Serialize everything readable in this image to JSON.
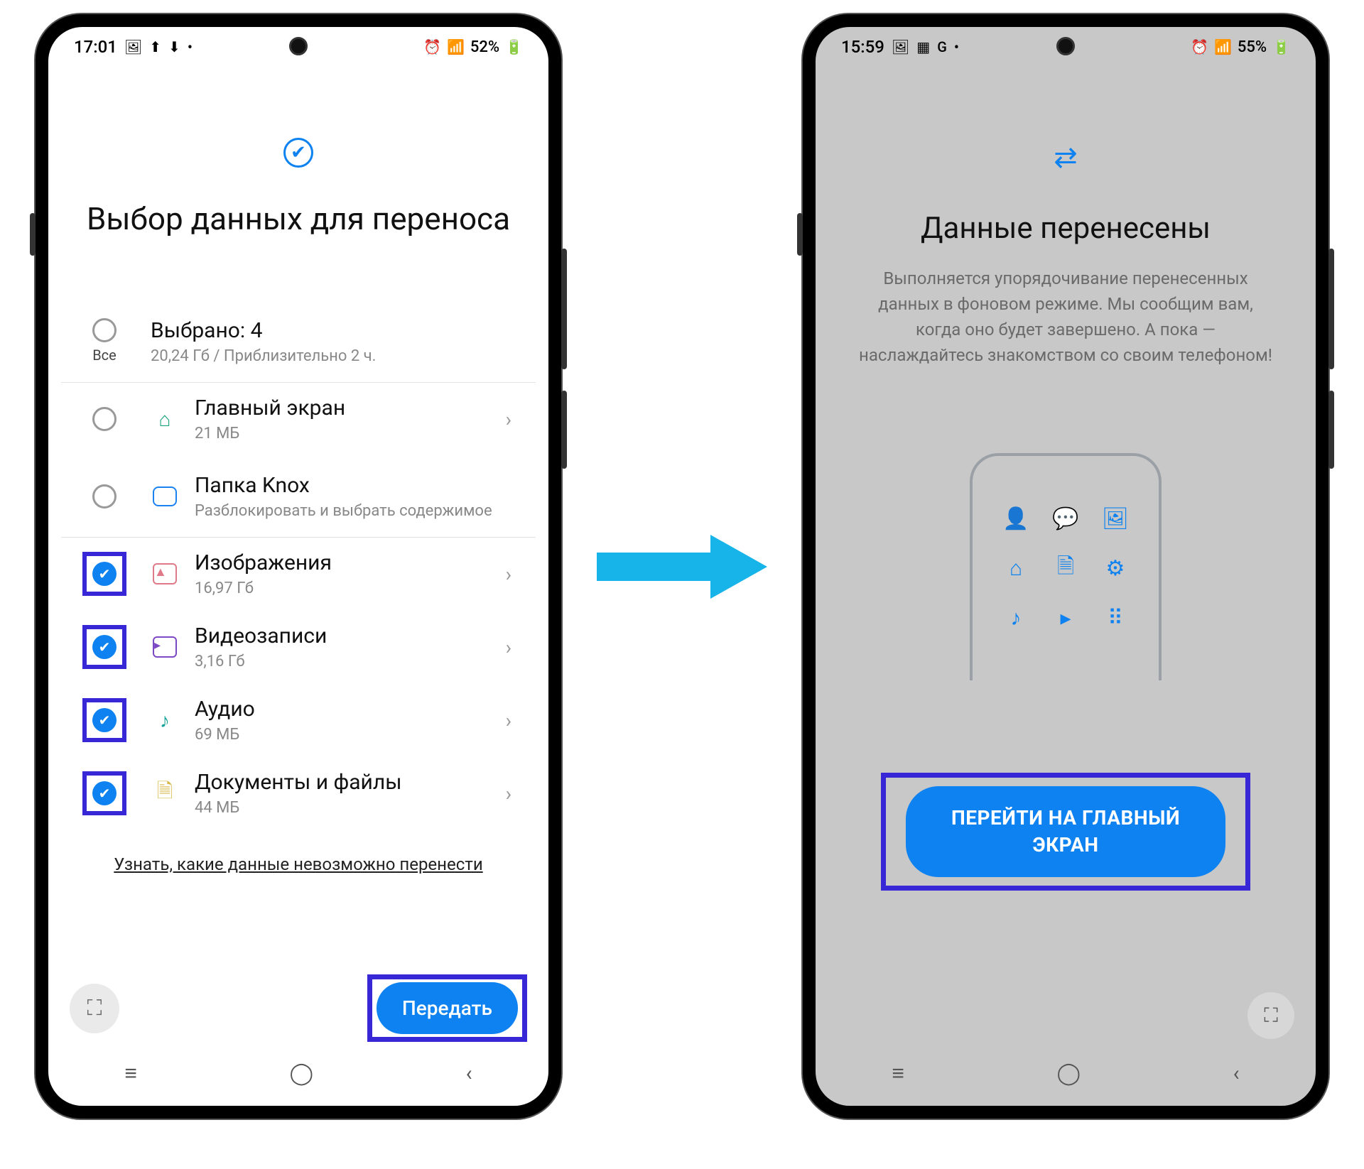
{
  "left": {
    "status": {
      "time": "17:01",
      "battery": "52%"
    },
    "title": "Выбор данных для переноса",
    "selectAll": {
      "label_all": "Все",
      "count": "Выбрано: 4",
      "size": "20,24 Гб / Приблизительно 2 ч."
    },
    "items": [
      {
        "title": "Главный экран",
        "sub": "21 МБ",
        "checked": false
      },
      {
        "title": "Папка Knox",
        "sub": "Разблокировать и выбрать содержимое",
        "checked": false
      },
      {
        "title": "Изображения",
        "sub": "16,97 Гб",
        "checked": true
      },
      {
        "title": "Видеозаписи",
        "sub": "3,16 Гб",
        "checked": true
      },
      {
        "title": "Аудио",
        "sub": "69 МБ",
        "checked": true
      },
      {
        "title": "Документы и файлы",
        "sub": "44 МБ",
        "checked": true
      }
    ],
    "cannot_transfer": "Узнать, какие данные невозможно перенести",
    "send_button": "Передать"
  },
  "right": {
    "status": {
      "time": "15:59",
      "battery": "55%"
    },
    "title": "Данные перенесены",
    "subtitle": "Выполняется упорядочивание перенесенных данных в фоновом режиме. Мы сообщим вам, когда оно будет завершено. А пока — наслаждайтесь знакомством со своим телефоном!",
    "goto_button": "ПЕРЕЙТИ НА ГЛАВНЫЙ ЭКРАН"
  }
}
